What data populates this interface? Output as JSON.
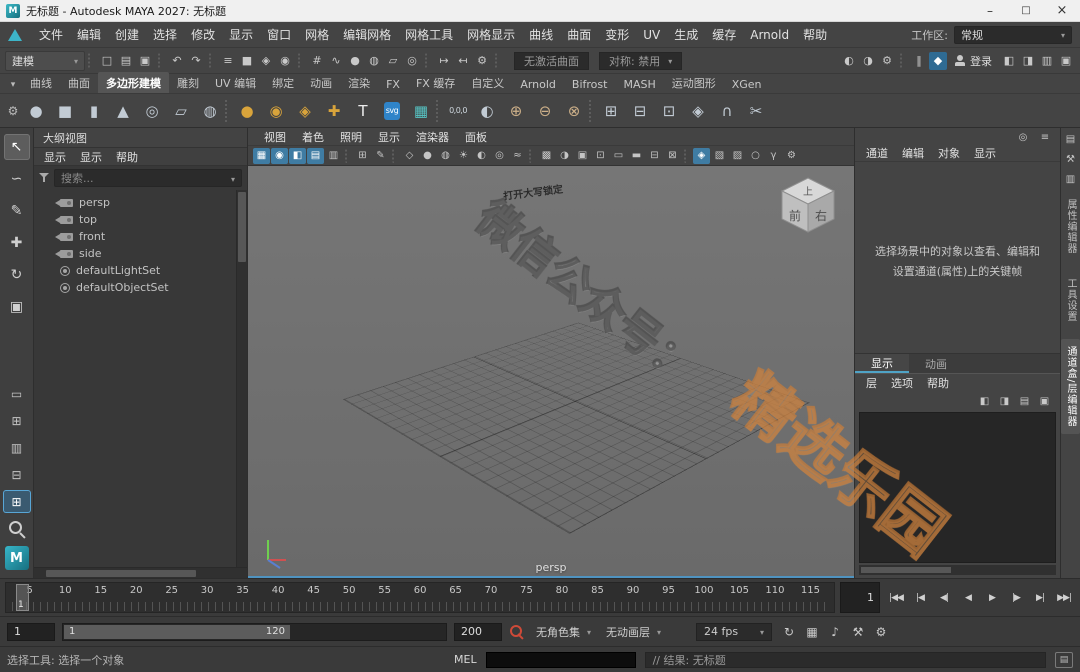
{
  "titlebar": {
    "title": "无标题 - Autodesk MAYA 2027: 无标题"
  },
  "menubar": {
    "items": [
      "文件",
      "编辑",
      "创建",
      "选择",
      "修改",
      "显示",
      "窗口",
      "网格",
      "编辑网格",
      "网格工具",
      "网格显示",
      "曲线",
      "曲面",
      "变形",
      "UV",
      "生成",
      "缓存",
      "Arnold",
      "帮助"
    ],
    "workspace_label": "工作区:",
    "workspace_value": "常规"
  },
  "statusline": {
    "mode": "建模",
    "left_icons": [
      {
        "cls": "sep"
      },
      {
        "name": "new-scene-icon",
        "glyph": "□"
      },
      {
        "name": "open-scene-icon",
        "glyph": "▤"
      },
      {
        "name": "save-scene-icon",
        "glyph": "▣"
      },
      {
        "cls": "sep"
      },
      {
        "name": "undo-icon",
        "glyph": "↶"
      },
      {
        "name": "redo-icon",
        "glyph": "↷"
      },
      {
        "cls": "sep"
      },
      {
        "name": "select-hierarchy-icon",
        "glyph": "≡"
      },
      {
        "name": "select-object-icon",
        "glyph": "■"
      },
      {
        "name": "select-component-icon",
        "glyph": "◈"
      },
      {
        "name": "select-highlight-icon",
        "glyph": "◉"
      },
      {
        "cls": "sep"
      },
      {
        "name": "snap-grid-icon",
        "glyph": "#"
      },
      {
        "name": "snap-curve-icon",
        "glyph": "∿"
      },
      {
        "name": "snap-point-icon",
        "glyph": "●"
      },
      {
        "name": "snap-projection-icon",
        "glyph": "◍"
      },
      {
        "name": "snap-viewplane-icon",
        "glyph": "▱"
      },
      {
        "name": "make-live-icon",
        "glyph": "◎"
      },
      {
        "cls": "sep"
      },
      {
        "name": "input-connections-icon",
        "glyph": "↦"
      },
      {
        "name": "output-connections-icon",
        "glyph": "↤"
      },
      {
        "name": "construction-history-icon",
        "glyph": "⚙"
      },
      {
        "cls": "sep"
      }
    ],
    "no_active_surface": "无激活曲面",
    "symmetry": "对称: 禁用",
    "right_icons": [
      {
        "name": "render-current-frame-icon",
        "glyph": "◐"
      },
      {
        "name": "ipr-render-icon",
        "glyph": "◑"
      },
      {
        "name": "render-settings-icon",
        "glyph": "⚙"
      },
      {
        "cls": "sep"
      },
      {
        "name": "pause-evaluation-icon",
        "glyph": "‖"
      },
      {
        "name": "maya-assistant-icon",
        "glyph": "◆",
        "active": true
      }
    ],
    "login_label": "登录",
    "panel_toggles": [
      {
        "name": "toggle-ui-left-icon",
        "glyph": "◧"
      },
      {
        "name": "toggle-ui-right-icon",
        "glyph": "◨"
      },
      {
        "name": "toggle-channelbox-icon",
        "glyph": "▥"
      },
      {
        "name": "toggle-single-pane-icon",
        "glyph": "▣"
      }
    ]
  },
  "shelf": {
    "tabs": [
      {
        "label": "曲线"
      },
      {
        "label": "曲面"
      },
      {
        "label": "多边形建模",
        "active": true
      },
      {
        "label": "雕刻"
      },
      {
        "label": "UV 编辑"
      },
      {
        "label": "绑定"
      },
      {
        "label": "动画"
      },
      {
        "label": "渲染"
      },
      {
        "label": "FX"
      },
      {
        "label": "FX 缓存"
      },
      {
        "label": "自定义"
      },
      {
        "label": "Arnold"
      },
      {
        "label": "Bifrost"
      },
      {
        "label": "MASH"
      },
      {
        "label": "运动图形"
      },
      {
        "label": "XGen"
      }
    ],
    "icons": [
      {
        "name": "poly-sphere-icon",
        "glyph": "●",
        "color": "#c2cbd4"
      },
      {
        "name": "poly-cube-icon",
        "glyph": "■",
        "color": "#c2cbd4"
      },
      {
        "name": "poly-cylinder-icon",
        "glyph": "▮",
        "color": "#c2cbd4"
      },
      {
        "name": "poly-cone-icon",
        "glyph": "▲",
        "color": "#c2cbd4"
      },
      {
        "name": "poly-torus-icon",
        "glyph": "◎",
        "color": "#c2cbd4"
      },
      {
        "name": "poly-plane-icon",
        "glyph": "▱",
        "color": "#c2cbd4"
      },
      {
        "name": "poly-disc-icon",
        "glyph": "◍",
        "color": "#c2cbd4"
      },
      {
        "cls": "sep"
      },
      {
        "name": "sculpt-tool-icon",
        "glyph": "●",
        "color": "#d9a43b"
      },
      {
        "name": "smooth-sculpt-icon",
        "glyph": "◉",
        "color": "#d9a43b"
      },
      {
        "name": "grab-sculpt-icon",
        "glyph": "◈",
        "color": "#d9a43b"
      },
      {
        "name": "knife-sculpt-icon",
        "glyph": "✚",
        "color": "#d9a43b"
      },
      {
        "name": "text-tool-icon",
        "glyph": "T",
        "color": "#ececec"
      },
      {
        "name": "svg-tool-icon",
        "glyph": "svg",
        "color": "#ffffff",
        "bg": "#2f84c9",
        "cls": "tiny"
      },
      {
        "name": "type-mesh-icon",
        "glyph": "▦",
        "color": "#56c4c4"
      },
      {
        "cls": "sep"
      },
      {
        "name": "snap-to-origin-icon",
        "glyph": "0,0,0",
        "color": "#cfd8df",
        "cls": "tiny"
      },
      {
        "name": "mirror-icon",
        "glyph": "◐",
        "color": "#c2cbd4"
      },
      {
        "name": "boolean-union-icon",
        "glyph": "⊕",
        "color": "#cdb089"
      },
      {
        "name": "boolean-difference-icon",
        "glyph": "⊖",
        "color": "#cdb089"
      },
      {
        "name": "boolean-intersection-icon",
        "glyph": "⊗",
        "color": "#cdb089"
      },
      {
        "cls": "sep"
      },
      {
        "name": "combine-icon",
        "glyph": "⊞",
        "color": "#c2cbd4"
      },
      {
        "name": "separate-icon",
        "glyph": "⊟",
        "color": "#c2cbd4"
      },
      {
        "name": "extrude-icon",
        "glyph": "⊡",
        "color": "#c2cbd4"
      },
      {
        "name": "bevel-icon",
        "glyph": "◈",
        "color": "#c2cbd4"
      },
      {
        "name": "bridge-icon",
        "glyph": "∩",
        "color": "#c2cbd4"
      },
      {
        "name": "multi-cut-icon",
        "glyph": "✂",
        "color": "#c2cbd4"
      }
    ]
  },
  "toolbox": {
    "tools": [
      {
        "name": "select-tool",
        "glyph": "↖",
        "active": true
      },
      {
        "name": "lasso-select-tool",
        "glyph": "∽"
      },
      {
        "name": "paint-select-tool",
        "glyph": "✎"
      },
      {
        "name": "move-tool",
        "glyph": "✚"
      },
      {
        "name": "rotate-tool",
        "glyph": "↻"
      },
      {
        "name": "scale-tool",
        "glyph": "▣"
      }
    ],
    "layouts": [
      {
        "name": "layout-single-pane-button",
        "glyph": "▭"
      },
      {
        "name": "layout-four-pane-button",
        "glyph": "⊞"
      },
      {
        "name": "layout-persp-outliner-button",
        "glyph": "▥"
      },
      {
        "name": "layout-hypershade-persp-button",
        "glyph": "⊟"
      },
      {
        "name": "layout-custom-button",
        "glyph": "⊞",
        "active": true
      }
    ]
  },
  "outliner": {
    "title": "大纲视图",
    "menus": [
      "显示",
      "显示",
      "帮助"
    ],
    "search_placeholder": "搜索...",
    "items": [
      {
        "label": "persp",
        "icon": "ic-camera"
      },
      {
        "label": "top",
        "icon": "ic-camera"
      },
      {
        "label": "front",
        "icon": "ic-camera"
      },
      {
        "label": "side",
        "icon": "ic-camera"
      },
      {
        "label": "defaultLightSet",
        "icon": "ic-set"
      },
      {
        "label": "defaultObjectSet",
        "icon": "ic-set"
      }
    ]
  },
  "viewport": {
    "menus": [
      "视图",
      "着色",
      "照明",
      "显示",
      "渲染器",
      "面板"
    ],
    "toolbar_icons": [
      {
        "name": "select-camera-icon",
        "glyph": "▦",
        "active": true
      },
      {
        "name": "lock-camera-icon",
        "glyph": "◉",
        "active": true
      },
      {
        "name": "camera-attributes-icon",
        "glyph": "◧",
        "active": true
      },
      {
        "name": "bookmarks-icon",
        "glyph": "▤",
        "active": true
      },
      {
        "name": "image-plane-icon",
        "glyph": "▥"
      },
      {
        "cls": "sep"
      },
      {
        "name": "2d-pan-zoom-icon",
        "glyph": "⊞"
      },
      {
        "name": "grease-pencil-icon",
        "glyph": "✎"
      },
      {
        "cls": "sep"
      },
      {
        "name": "wireframe-icon",
        "glyph": "◇"
      },
      {
        "name": "shaded-icon",
        "glyph": "●"
      },
      {
        "name": "textured-icon",
        "glyph": "◍"
      },
      {
        "name": "lights-icon",
        "glyph": "☀"
      },
      {
        "name": "shadows-icon",
        "glyph": "◐"
      },
      {
        "name": "ambient-occlusion-icon",
        "glyph": "◎"
      },
      {
        "name": "motion-blur-icon",
        "glyph": "≈"
      },
      {
        "cls": "sep"
      },
      {
        "name": "multisample-icon",
        "glyph": "▩"
      },
      {
        "name": "depth-of-field-icon",
        "glyph": "◑"
      },
      {
        "name": "isolate-select-icon",
        "glyph": "▣"
      },
      {
        "name": "field-chart-icon",
        "glyph": "⊡"
      },
      {
        "name": "resolution-gate-icon",
        "glyph": "▭"
      },
      {
        "name": "gate-mask-icon",
        "glyph": "▬"
      },
      {
        "name": "safe-action-icon",
        "glyph": "⊟"
      },
      {
        "name": "safe-title-icon",
        "glyph": "⊠"
      },
      {
        "cls": "sep"
      },
      {
        "name": "highlight-selection-icon",
        "glyph": "◈",
        "active": true
      },
      {
        "name": "xray-icon",
        "glyph": "▧"
      },
      {
        "name": "xray-joints-icon",
        "glyph": "▨"
      },
      {
        "name": "exposure-icon",
        "glyph": "○"
      },
      {
        "name": "gamma-icon",
        "glyph": "γ"
      },
      {
        "name": "viewport-settings-icon",
        "glyph": "⚙"
      }
    ],
    "camera_label": "persp",
    "capslock": "打开大写锁定",
    "viewcube": {
      "top": "上",
      "left": "前",
      "right": "右"
    }
  },
  "channelbox": {
    "top_icons": [
      {
        "name": "show-manipulators-icon",
        "glyph": "◎"
      },
      {
        "name": "channel-settings-icon",
        "glyph": "≡"
      }
    ],
    "menus": [
      "通道",
      "编辑",
      "对象",
      "显示"
    ],
    "message": "选择场景中的对象以查看、编辑和设置通道(属性)上的关键帧"
  },
  "layer_editor": {
    "tabs": [
      {
        "label": "显示",
        "active": true
      },
      {
        "label": "动画"
      }
    ],
    "menus": [
      "层",
      "选项",
      "帮助"
    ],
    "icons": [
      {
        "name": "new-empty-layer-icon",
        "glyph": "◧"
      },
      {
        "name": "new-layer-from-selected-icon",
        "glyph": "◨"
      },
      {
        "name": "new-display-layer-icon",
        "glyph": "▤"
      },
      {
        "name": "layer-options-icon",
        "glyph": "▣"
      }
    ]
  },
  "rightstrip": {
    "icons": [
      {
        "name": "sidebar-attribute-editor-icon",
        "glyph": "▤"
      },
      {
        "name": "sidebar-tool-settings-icon",
        "glyph": "⚒"
      },
      {
        "name": "sidebar-channel-box-icon",
        "glyph": "▥"
      }
    ],
    "tabs": [
      {
        "label": "属性编辑器"
      },
      {
        "label": "工具设置"
      },
      {
        "label": "通道盒/层编辑器",
        "active": true
      }
    ]
  },
  "timeline": {
    "ticks": [
      "5",
      "10",
      "15",
      "20",
      "25",
      "30",
      "35",
      "40",
      "45",
      "50",
      "55",
      "60",
      "65",
      "70",
      "75",
      "80",
      "85",
      "90",
      "95",
      "100",
      "105",
      "110",
      "115"
    ],
    "playhead": "1",
    "current_frame": "1",
    "playback": [
      {
        "name": "go-to-start-button",
        "glyph": "|◀◀"
      },
      {
        "name": "step-back-key-button",
        "glyph": "|◀"
      },
      {
        "name": "step-back-frame-button",
        "glyph": "◀|"
      },
      {
        "name": "play-backwards-button",
        "glyph": "◀"
      },
      {
        "name": "play-forwards-button",
        "glyph": "▶"
      },
      {
        "name": "step-forward-frame-button",
        "glyph": "|▶"
      },
      {
        "name": "step-forward-key-button",
        "glyph": "▶|"
      },
      {
        "name": "go-to-end-button",
        "glyph": "▶▶|"
      }
    ]
  },
  "range": {
    "start": "1",
    "inner_start": "1",
    "inner_end": "120",
    "end": "200",
    "character_set": "无角色集",
    "anim_layer": "无动画层",
    "fps": "24 fps",
    "icons": [
      {
        "name": "playback-loop-icon",
        "glyph": "↻"
      },
      {
        "name": "time-editor-icon",
        "glyph": "▦"
      },
      {
        "name": "mute-audio-icon",
        "glyph": "♪"
      },
      {
        "name": "evaluation-toolkit-icon",
        "glyph": "⚒"
      },
      {
        "name": "animation-preferences-icon",
        "glyph": "⚙"
      }
    ]
  },
  "commandline": {
    "label": "MEL",
    "result": "// 结果: 无标题"
  },
  "helpline": {
    "text": "选择工具: 选择一个对象"
  },
  "watermark": {
    "line1": "微信公众号：",
    "line2": "精选乐园"
  }
}
